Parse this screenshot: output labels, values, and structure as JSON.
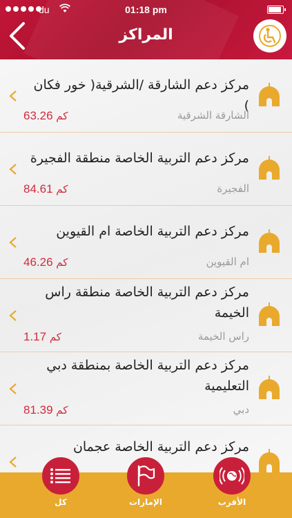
{
  "status": {
    "carrier": "du",
    "time": "01:18 pm"
  },
  "header": {
    "title": "المراكز"
  },
  "icons": {
    "back": "chevron-left-icon",
    "accessibility": "wheelchair-icon",
    "item": "mosque-icon",
    "list_tab": "list-icon",
    "emirates_tab": "flag-icon",
    "nearest_tab": "globe-signal-icon"
  },
  "colors": {
    "accent": "#c21638",
    "gold": "#e9a92c",
    "distance": "#d12a3c",
    "divider": "#f0c9a8"
  },
  "items": [
    {
      "title": "مركز دعم الشارقة /الشرقية( خور فكان )",
      "city": "الشارقة الشرقية",
      "distance": "63.26",
      "unit": "كم"
    },
    {
      "title": "مركز دعم التربية الخاصة منطقة الفجيرة",
      "city": "الفجيرة",
      "distance": "84.61",
      "unit": "كم"
    },
    {
      "title": "مركز دعم التربية الخاصة  ام القيوين",
      "city": "ام القيوين",
      "distance": "46.26",
      "unit": "كم"
    },
    {
      "title": "مركز دعم التربية الخاصة منطقة راس الخيمة",
      "city": "راس الخيمة",
      "distance": "1.17",
      "unit": "كم"
    },
    {
      "title": "مركز دعم التربية الخاصة  بمنطقة دبي التعليمية",
      "city": "دبي",
      "distance": "81.39",
      "unit": "كم"
    },
    {
      "title": "مركز دعم التربية الخاصة عجمان",
      "city": "",
      "distance": "",
      "unit": ""
    }
  ],
  "tabs": [
    {
      "label": "كل"
    },
    {
      "label": "الإمارات"
    },
    {
      "label": "الأقرب"
    }
  ]
}
